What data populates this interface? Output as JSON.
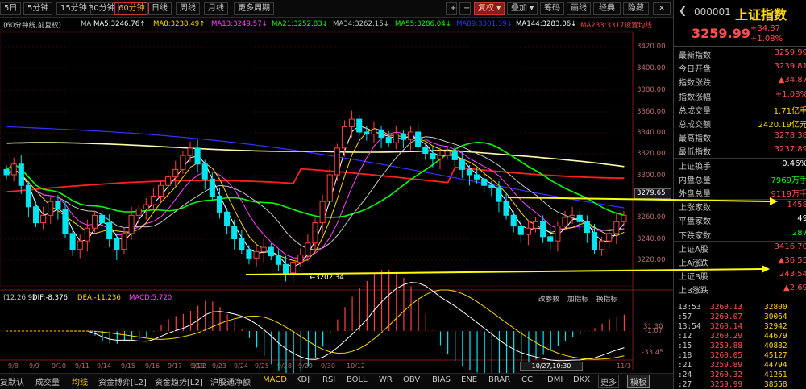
{
  "toolbar": {
    "period_tabs": [
      "5日",
      "5分钟",
      "15分钟",
      "30分钟",
      "60分钟",
      "日线",
      "周线",
      "月线",
      "更多周期"
    ],
    "active_period": "60分钟",
    "right_buttons": [
      "复权",
      "叠加",
      "筹码",
      "画线",
      "经典",
      "隐藏"
    ],
    "nav_symbols": [
      "+",
      "−",
      "▾"
    ]
  },
  "indicator_line": {
    "prefix": "(60分钟线,前复权)",
    "items": [
      {
        "label": "MA",
        "value": "",
        "color": "#c8c8c8"
      },
      {
        "label": "MA5:3246.76",
        "value": "↑",
        "color": "#ffffff"
      },
      {
        "label": "MA8:3238.49",
        "value": "↑",
        "color": "#ffd700"
      },
      {
        "label": "MA13:3249.57",
        "value": "↓",
        "color": "#ff44ff"
      },
      {
        "label": "MA21:3252.83",
        "value": "↓",
        "color": "#00ff00"
      },
      {
        "label": "MA34:3262.15",
        "value": "↓",
        "color": "#c8c8c8"
      },
      {
        "label": "MA55:3286.04",
        "value": "↓",
        "color": "#00ff00"
      },
      {
        "label": "MA89:3301.39",
        "value": "↓",
        "color": "#3333ff"
      },
      {
        "label": "MA144:3283.06",
        "value": "↓",
        "color": "#ffffff"
      },
      {
        "label": "MA233:3317",
        "value": "设置均线",
        "color": "#ff4444"
      }
    ]
  },
  "macd_line": {
    "params": "(12,26,9)",
    "dif": "DIF:-8.376",
    "dea": "DEA:-11.236",
    "macd": "MACD:5.720",
    "buttons": [
      "改参数",
      "加指标",
      "换指标"
    ]
  },
  "price_axis": {
    "labels": [
      "3420.00",
      "3400.00",
      "3380.00",
      "3360.00",
      "3340.00",
      "3320.00",
      "3300.00",
      "3279.65",
      "3260.00",
      "3240.00",
      "3220.00"
    ],
    "current": "3279.65"
  },
  "macd_axis": {
    "labels": [
      "31.30",
      "-1.07",
      "-33.45"
    ]
  },
  "low_marker": "3202.34",
  "time_axis": {
    "labels": [
      "9/8",
      "9/9",
      "9/10",
      "9/11",
      "9/14",
      "9/15",
      "9/16",
      "9/17",
      "9/18",
      "9/22",
      "9/23",
      "9/24",
      "9/25",
      "9/28",
      "9/29",
      "9/30",
      "10/12",
      "10/27,10:30",
      "11/3"
    ]
  },
  "bottom_tabs": [
    "复默认",
    "成交量",
    "均线",
    "资金博弈[L2]",
    "资金趋势[L2]",
    "沪股通净额",
    "MACD",
    "KDJ",
    "RSI",
    "BOLL",
    "WR",
    "OBV",
    "BIAS",
    "ENE",
    "BRAR",
    "CCI",
    "DMI",
    "DKX",
    "更多",
    "模板"
  ],
  "active_bottom_tab": "MACD",
  "quote": {
    "code": "000001",
    "name": "上证指数",
    "price": "3259.99",
    "change": "+34.87",
    "change_pct": "+1.08%",
    "stats": [
      {
        "label": "最新指数",
        "value": "3259.99",
        "color": "#ff5050"
      },
      {
        "label": "今日开盘",
        "value": "3239.81",
        "color": "#ff5050"
      },
      {
        "label": "指数涨跌",
        "value": "▲34.87",
        "color": "#ff5050"
      },
      {
        "label": "指数涨幅",
        "value": "+1.08%",
        "color": "#ff5050"
      },
      {
        "label": "总成交量",
        "value": "1.71亿手",
        "color": "#ffd700"
      },
      {
        "label": "总成交额",
        "value": "2420.19亿元",
        "color": "#ffd700"
      },
      {
        "label": "最高指数",
        "value": "3278.38",
        "color": "#ff5050"
      },
      {
        "label": "最低指数",
        "value": "3237.89",
        "color": "#ff5050"
      },
      {
        "label": "上证换手",
        "value": "0.46%",
        "color": "#ffffff"
      },
      {
        "label": "内盘总量",
        "value": "7969万手",
        "color": "#00ff00"
      },
      {
        "label": "外盘总量",
        "value": "9119万手",
        "color": "#ff5050"
      },
      {
        "label": "上涨家数",
        "value": "1458",
        "color": "#ff5050"
      },
      {
        "label": "平盘家数",
        "value": "49",
        "color": "#ffffff"
      },
      {
        "label": "下跌家数",
        "value": "287",
        "color": "#00ff00"
      },
      {
        "label": "上证A股",
        "value": "3416.70",
        "color": "#ff5050"
      },
      {
        "label": "上A涨跌",
        "value": "▲36.55",
        "color": "#ff5050"
      },
      {
        "label": "上证B股",
        "value": "243.54",
        "color": "#ff5050"
      },
      {
        "label": "上B涨跌",
        "value": "▲2.69",
        "color": "#ff5050"
      }
    ],
    "ticks": [
      {
        "time": "13:53",
        "price": "3260.13",
        "vol": "32800"
      },
      {
        "time": ":57",
        "price": "3260.07",
        "vol": "30064"
      },
      {
        "time": "13:54",
        "price": "3260.14",
        "vol": "32942"
      },
      {
        "time": ":12",
        "price": "3260.29",
        "vol": "44679"
      },
      {
        "time": ":15",
        "price": "3259.88",
        "vol": "40882"
      },
      {
        "time": ":18",
        "price": "3260.05",
        "vol": "45127"
      },
      {
        "time": ":21",
        "price": "3259.89",
        "vol": "44794"
      },
      {
        "time": ":24",
        "price": "3260.32",
        "vol": "41261"
      },
      {
        "time": ":27",
        "price": "3259.99",
        "vol": "38558"
      }
    ]
  }
}
